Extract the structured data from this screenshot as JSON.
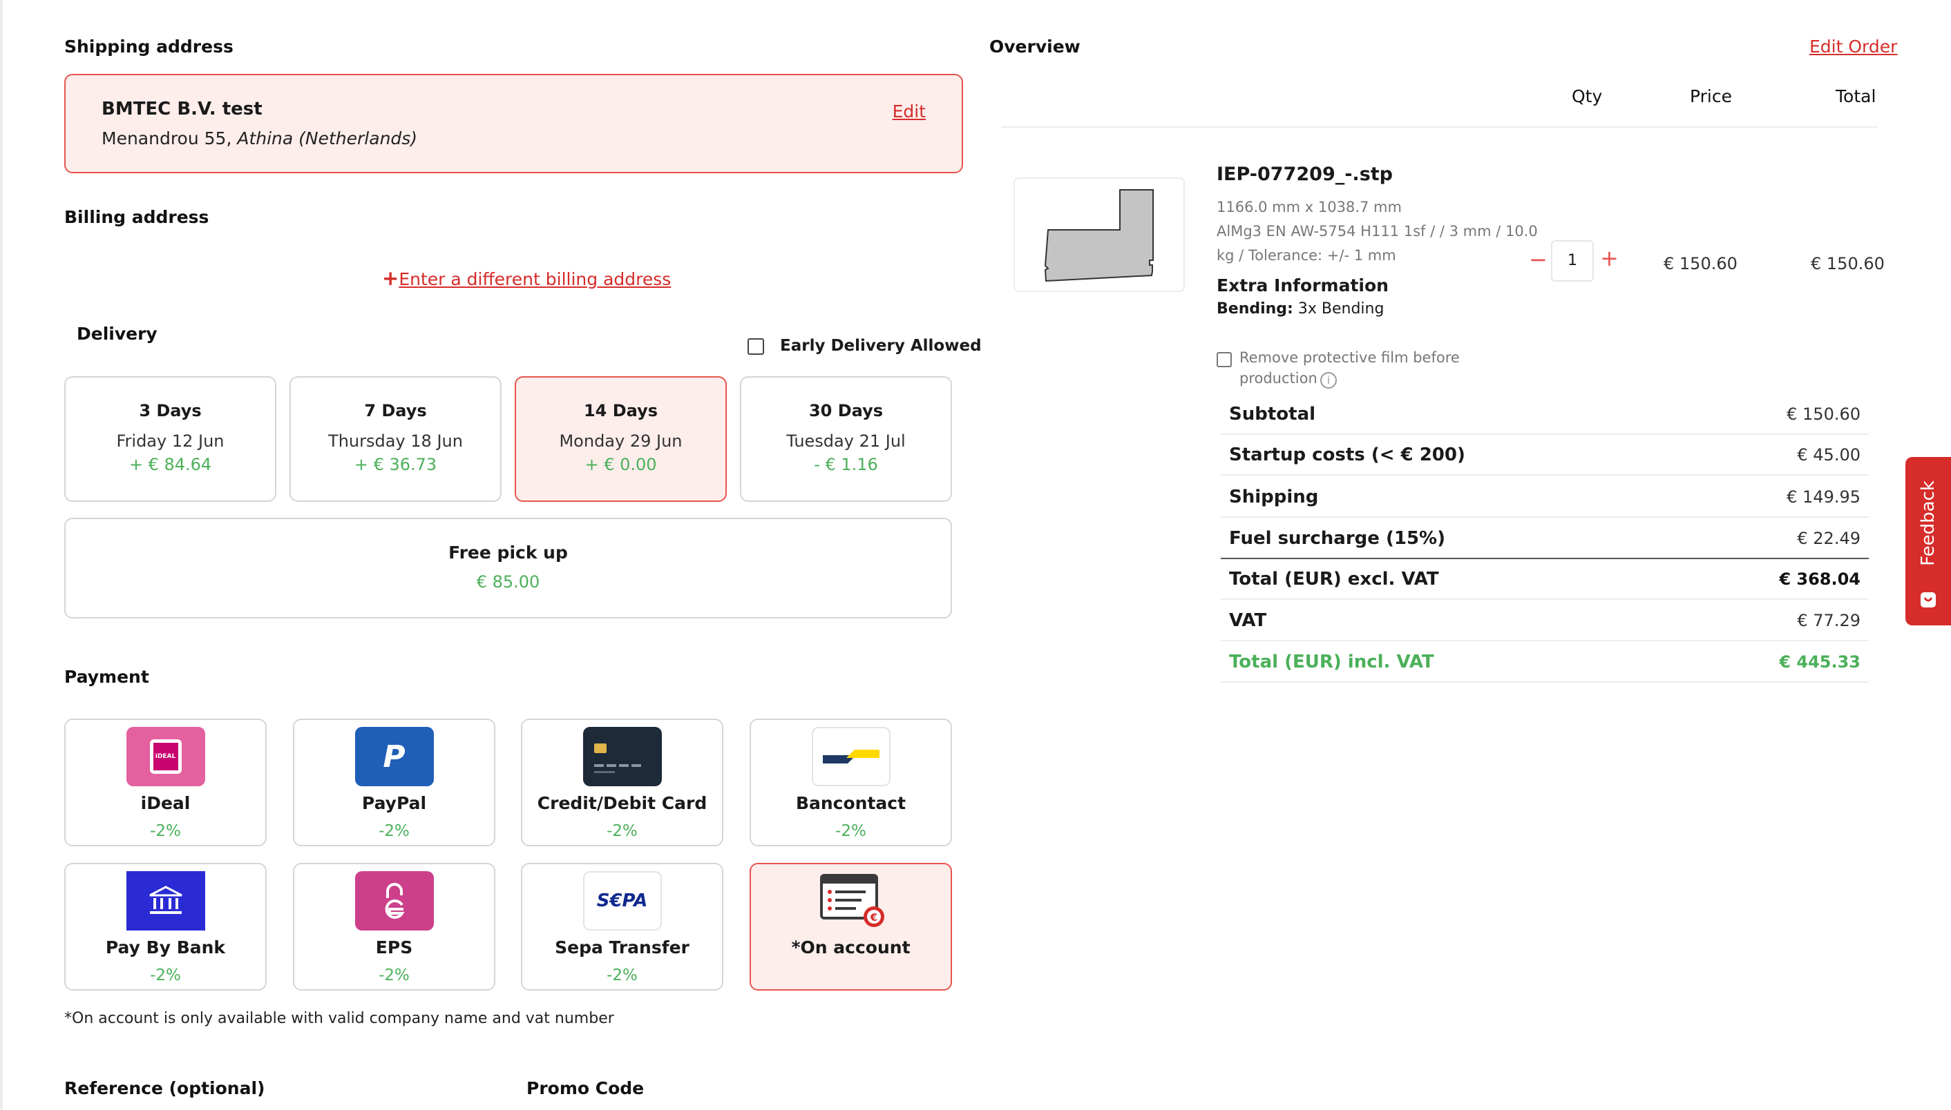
{
  "shipping": {
    "title": "Shipping address",
    "company": "BMTEC B.V. test",
    "address_plain": "Menandrou 55,",
    "address_city_italic": "Athina (Netherlands)",
    "edit_label": "Edit"
  },
  "billing": {
    "title": "Billing address",
    "plus": "+",
    "link_label": "Enter a different billing address"
  },
  "delivery": {
    "title": "Delivery",
    "early_label": "Early Delivery Allowed",
    "options": [
      {
        "title": "3 Days",
        "date": "Friday 12 Jun",
        "price": "+ € 84.64"
      },
      {
        "title": "7 Days",
        "date": "Thursday 18 Jun",
        "price": "+ € 36.73"
      },
      {
        "title": "14 Days",
        "date": "Monday 29 Jun",
        "price": "+ € 0.00"
      },
      {
        "title": "30 Days",
        "date": "Tuesday 21 Jul",
        "price": "- € 1.16"
      }
    ],
    "pickup": {
      "title": "Free pick up",
      "price": "€ 85.00"
    }
  },
  "payment": {
    "title": "Payment",
    "methods": [
      {
        "name": "iDeal",
        "discount": "-2%",
        "icon": "ideal-icon"
      },
      {
        "name": "PayPal",
        "discount": "-2%",
        "icon": "paypal-icon"
      },
      {
        "name": "Credit/Debit Card",
        "discount": "-2%",
        "icon": "credit-card-icon"
      },
      {
        "name": "Bancontact",
        "discount": "-2%",
        "icon": "bancontact-icon"
      },
      {
        "name": "Pay By Bank",
        "discount": "-2%",
        "icon": "bank-icon"
      },
      {
        "name": "EPS",
        "discount": "-2%",
        "icon": "eps-icon"
      },
      {
        "name": "Sepa Transfer",
        "discount": "-2%",
        "icon": "sepa-icon"
      },
      {
        "name": "*On account",
        "discount": "",
        "icon": "invoice-euro-icon"
      }
    ],
    "sepa_logo_text": "S€PA",
    "ideal_logo_text": "iDEAL",
    "note": "*On account is only available with valid company name and vat number"
  },
  "reference": {
    "title": "Reference (optional)"
  },
  "promo": {
    "title": "Promo Code"
  },
  "overview": {
    "title": "Overview",
    "edit_order": "Edit Order",
    "col_qty": "Qty",
    "col_price": "Price",
    "col_total": "Total",
    "item": {
      "name": "IEP-077209_-.stp",
      "dims": "1166.0 mm x 1038.7 mm",
      "spec_line1": "AlMg3 EN AW-5754 H111 1sf / / 3 mm / 10.0",
      "spec_line2": "kg / Tolerance: +/- 1 mm",
      "extra_title": "Extra Information",
      "bending_label": "Bending:",
      "bending_value": "3x Bending",
      "qty": "1",
      "minus": "−",
      "plus": "+",
      "price": "€ 150.60",
      "total": "€ 150.60",
      "film_line1": "Remove protective film before",
      "film_line2": "production",
      "info_glyph": "i"
    },
    "summary": [
      {
        "label": "Subtotal",
        "value": "€ 150.60"
      },
      {
        "label": "Startup costs (< € 200)",
        "value": "€ 45.00"
      },
      {
        "label": "Shipping",
        "value": "€ 149.95"
      },
      {
        "label": "Fuel surcharge (15%)",
        "value": "€ 22.49"
      },
      {
        "label": "Total (EUR) excl. VAT",
        "value": "€ 368.04"
      },
      {
        "label": "VAT",
        "value": "€ 77.29"
      },
      {
        "label": "Total (EUR) incl. VAT",
        "value": "€ 445.33"
      }
    ]
  },
  "feedback": {
    "label": "Feedback"
  },
  "colors": {
    "accent_red": "#d62c2a",
    "selected_bg": "#fdeeec",
    "green": "#4bb05a"
  }
}
